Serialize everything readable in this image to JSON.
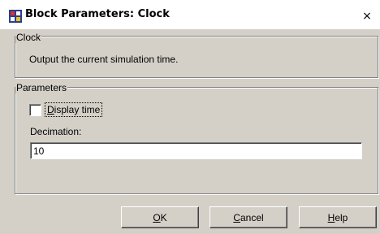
{
  "window": {
    "title": "Block Parameters: Clock",
    "close_label": "×"
  },
  "clock_group": {
    "legend": "Clock",
    "description": "Output the current simulation time."
  },
  "parameters_group": {
    "legend": "Parameters",
    "display_time": {
      "label_mnemonic": "D",
      "label_rest": "isplay time",
      "checked": false
    },
    "decimation": {
      "label": "Decimation:",
      "value": "10"
    }
  },
  "buttons": {
    "ok_mnemonic": "O",
    "ok_rest": "K",
    "cancel_mnemonic": "C",
    "cancel_rest": "ancel",
    "help_mnemonic": "H",
    "help_rest": "elp"
  },
  "colors": {
    "dialog_bg": "#d4d0c8",
    "titlebar_bg": "#ffffff"
  },
  "icons": {
    "app": "simulink-block-icon",
    "close": "close-icon"
  }
}
